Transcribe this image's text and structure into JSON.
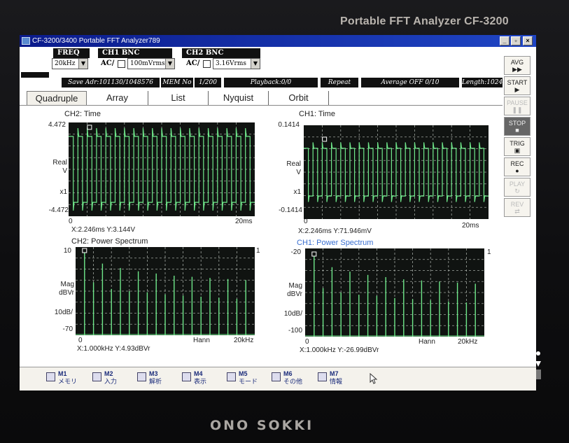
{
  "device": {
    "brand_title": "Portable FFT Analyzer  CF-3200",
    "maker": "ONO SOKKI"
  },
  "window": {
    "title": "CF-3200/3400 Portable FFT Analyzer789",
    "minimize": "_",
    "restore": "▫",
    "close": "×"
  },
  "controls": {
    "freq_label": "FREQ",
    "freq_value": "20kHz",
    "ch1_label": "CH1  BNC",
    "ch1_coupling": "AC/",
    "ch1_range": "100mVrms",
    "ch2_label": "CH2  BNC",
    "ch2_coupling": "AC/",
    "ch2_range": "3.16Vrms"
  },
  "status": {
    "save_adr": "Save Adr:101130/1048576",
    "mem_no_label": "MEM No",
    "mem_no_value": "1/200",
    "playback": "Playback:0/0",
    "repeat": "Repeat",
    "average": "Average OFF 0/10",
    "length": "Length:1024"
  },
  "tabs": [
    "Quadruple",
    "Array",
    "List",
    "Nyquist",
    "Orbit"
  ],
  "right_panel": {
    "avg": "AVG",
    "start": "START",
    "pause": "PAUSE",
    "stop": "STOP",
    "trig": "TRIG",
    "rec": "REC",
    "play": "PLAY",
    "rev": "REV"
  },
  "panels": {
    "ch2_time": {
      "title": "CH2: Time",
      "y_max": "4.472",
      "y_min": "-4.472",
      "ylabel_1": "Real",
      "ylabel_2": "V",
      "scale": "x1",
      "x_min": "0",
      "x_max": "20ms",
      "cursor": "X:2.246ms Y:3.144V"
    },
    "ch1_time": {
      "title": "CH1: Time",
      "y_max": "0.1414",
      "y_min": "-0.1414",
      "ylabel_1": "Real",
      "ylabel_2": "V",
      "scale": "x1",
      "x_min": "0",
      "x_max": "20ms",
      "cursor": "X:2.246ms Y:71.946mV"
    },
    "ch2_spec": {
      "title": "CH2: Power Spectrum",
      "y_max": "10",
      "y_min": "-70",
      "ylabel_1": "Mag",
      "ylabel_2": "dBVr",
      "scale": "10dB/",
      "x_min": "0",
      "window": "Hann",
      "x_max": "20kHz",
      "cursor": "X:1.000kHz Y:4.93dBVr",
      "right_tick": "1"
    },
    "ch1_spec": {
      "title": "CH1: Power Spectrum",
      "y_max": "-20",
      "y_min": "-100",
      "ylabel_1": "Mag",
      "ylabel_2": "dBVr",
      "scale": "10dB/",
      "x_min": "0",
      "window": "Hann",
      "x_max": "20kHz",
      "cursor": "X:1.000kHz Y:-26.99dBVr",
      "right_tick": "1"
    }
  },
  "chart_data": [
    {
      "type": "line",
      "title": "CH2: Time",
      "xlabel": "",
      "ylabel": "Real V",
      "xlim": [
        0,
        20
      ],
      "ylim": [
        -4.472,
        4.472
      ],
      "series": [
        {
          "name": "",
          "shape": "square wave with spikes",
          "frequency_khz": 1.0,
          "amplitude": 3.144
        }
      ]
    },
    {
      "type": "line",
      "title": "CH1: Time",
      "xlabel": "",
      "ylabel": "Real V",
      "xlim": [
        0,
        20
      ],
      "ylim": [
        -0.1414,
        0.1414
      ],
      "series": [
        {
          "name": "",
          "shape": "square wave with spikes",
          "frequency_khz": 1.0,
          "amplitude": 0.0719
        }
      ]
    },
    {
      "type": "bar",
      "title": "CH2: Power Spectrum",
      "xlabel": "",
      "ylabel": "Mag dBVr",
      "xlim": [
        0,
        20
      ],
      "ylim": [
        -70,
        10
      ],
      "x": [
        1,
        2,
        3,
        4,
        5,
        6,
        7,
        8,
        9,
        10,
        11,
        12,
        13,
        14,
        15,
        16,
        17,
        18,
        19
      ],
      "values": [
        4.93,
        -22,
        -5,
        -28,
        -9,
        -30,
        -12,
        -31,
        -14,
        -33,
        -16,
        -34,
        -17,
        -35,
        -18,
        -36,
        -19,
        -37,
        -20
      ]
    },
    {
      "type": "bar",
      "title": "CH1: Power Spectrum",
      "xlabel": "",
      "ylabel": "Mag dBVr",
      "xlim": [
        0,
        20
      ],
      "ylim": [
        -100,
        -20
      ],
      "x": [
        1,
        2,
        3,
        4,
        5,
        6,
        7,
        8,
        9,
        10,
        11,
        12,
        13,
        14,
        15,
        16,
        17,
        18,
        19
      ],
      "values": [
        -26.99,
        -56,
        -37,
        -60,
        -41,
        -62,
        -44,
        -63,
        -46,
        -65,
        -48,
        -66,
        -49,
        -67,
        -50,
        -68,
        -51,
        -69,
        -52
      ]
    }
  ],
  "taskbar": [
    {
      "key": "M1",
      "label": "メモリ",
      "icon": "floppy-icon"
    },
    {
      "key": "M2",
      "label": "入力",
      "icon": "input-icon"
    },
    {
      "key": "M3",
      "label": "解析",
      "icon": "analysis-icon"
    },
    {
      "key": "M4",
      "label": "表示",
      "icon": "display-icon"
    },
    {
      "key": "M5",
      "label": "モード",
      "icon": "mode-icon"
    },
    {
      "key": "M6",
      "label": "その他",
      "icon": "other-icon"
    },
    {
      "key": "M7",
      "label": "情報",
      "icon": "info-icon"
    }
  ],
  "colors": {
    "trace": "#6fe88a",
    "plot_bg": "#101311",
    "grid": "#cfd6cf",
    "title_bar": "#0b1b8c"
  }
}
